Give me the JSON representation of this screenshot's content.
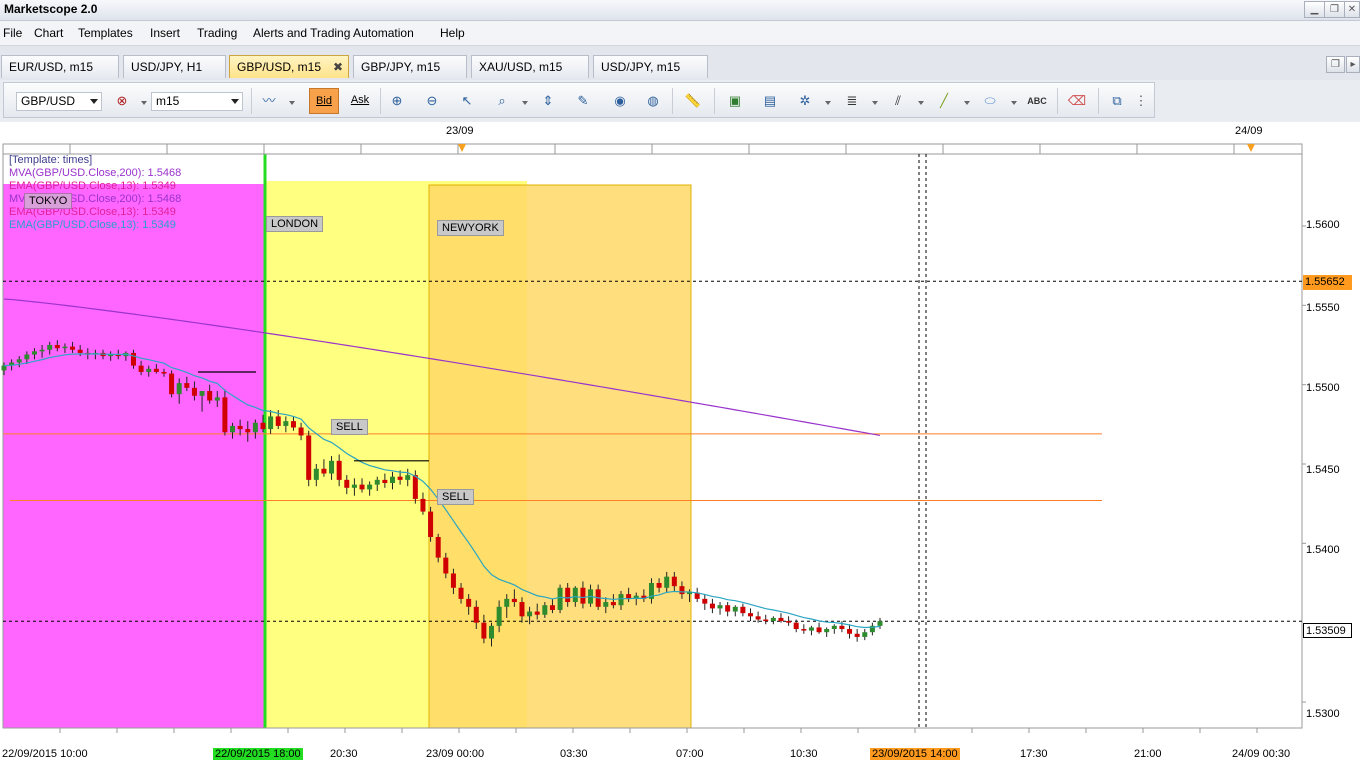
{
  "window": {
    "title": "Marketscope 2.0"
  },
  "menu": [
    "File",
    "Chart",
    "Templates",
    "Insert",
    "Trading",
    "Alerts and Trading Automation",
    "Help"
  ],
  "tabs": [
    {
      "label": "EUR/USD, m15"
    },
    {
      "label": "USD/JPY, H1"
    },
    {
      "label": "GBP/USD, m15",
      "close": "✖"
    },
    {
      "label": "GBP/JPY, m15"
    },
    {
      "label": "XAU/USD, m15"
    },
    {
      "label": "USD/JPY, m15"
    }
  ],
  "toolbar": {
    "symbol": "GBP/USD",
    "timeframe": "m15",
    "bid_label": "Bid",
    "ask_label": "Ask",
    "text_tool": "ABC"
  },
  "legend": [
    {
      "text": "[Template: times]",
      "color": "#3c3c8c"
    },
    {
      "text": "MVA(GBP/USD.Close,200): 1.5468",
      "color": "#9933cc"
    },
    {
      "text": "EMA(GBP/USD.Close,13): 1.5349",
      "color": "#e0209a"
    },
    {
      "text": "MVA(GBP/USD.Close,200): 1.5468",
      "color": "#9933cc"
    },
    {
      "text": "EMA(GBP/USD.Close,13): 1.5349",
      "color": "#e0209a"
    },
    {
      "text": "EMA(GBP/USD.Close,13): 1.5349",
      "color": "#2a9fc9"
    }
  ],
  "sessions": {
    "tokyo": "TOKYO",
    "london": "LONDON",
    "newyork": "NEWYORK"
  },
  "signals": {
    "sell1": "SELL",
    "sell2": "SELL"
  },
  "price_boxes": {
    "crosshair": "1.55652",
    "current": "1.53509"
  },
  "date_markers": {
    "top1": "23/09",
    "top2": "24/09"
  },
  "x_highlights": {
    "start": "22/09/2015 18:00",
    "end": "23/09/2015 14:00"
  },
  "colors": {
    "tokyo": "#ff66ff",
    "london": "#ffff80",
    "newyork": "#ffd966",
    "up": "#2e8b2e",
    "down": "#d00000",
    "ema": "#2aa5c2",
    "mva": "#9933cc",
    "level": "#ff7f27"
  },
  "chart_data": {
    "type": "candlestick",
    "y_ticks": [
      "1.5600",
      "1.5550",
      "1.5500",
      "1.5450",
      "1.5400",
      "1.5300"
    ],
    "x_ticks": [
      "22/09/2015 10:00",
      "22/09/2015 18:00",
      "20:30",
      "23/09 00:00",
      "03:30",
      "07:00",
      "10:30",
      "23/09/2015 14:00",
      "17:30",
      "21:00",
      "24/09 00:30"
    ],
    "ylim": [
      1.5285,
      1.565
    ],
    "candles": [
      [
        1.5509,
        1.5514,
        1.5506,
        1.5512
      ],
      [
        1.5512,
        1.5516,
        1.5509,
        1.5514
      ],
      [
        1.5514,
        1.5518,
        1.5511,
        1.5516
      ],
      [
        1.5516,
        1.5521,
        1.5513,
        1.5519
      ],
      [
        1.5519,
        1.5523,
        1.5516,
        1.5521
      ],
      [
        1.5521,
        1.5525,
        1.5517,
        1.5522
      ],
      [
        1.5522,
        1.5527,
        1.5519,
        1.5525
      ],
      [
        1.5525,
        1.5528,
        1.5521,
        1.5523
      ],
      [
        1.5523,
        1.5526,
        1.552,
        1.5524
      ],
      [
        1.5524,
        1.5527,
        1.552,
        1.5522
      ],
      [
        1.5522,
        1.5525,
        1.5518,
        1.552
      ],
      [
        1.552,
        1.5523,
        1.5516,
        1.5519
      ],
      [
        1.5519,
        1.5522,
        1.5516,
        1.552
      ],
      [
        1.552,
        1.5522,
        1.5516,
        1.5518
      ],
      [
        1.5518,
        1.5521,
        1.5515,
        1.5519
      ],
      [
        1.5519,
        1.5522,
        1.5516,
        1.5518
      ],
      [
        1.5518,
        1.5521,
        1.5515,
        1.552
      ],
      [
        1.552,
        1.5522,
        1.551,
        1.5512
      ],
      [
        1.5512,
        1.5515,
        1.5506,
        1.5508
      ],
      [
        1.5508,
        1.5512,
        1.5505,
        1.551
      ],
      [
        1.551,
        1.5513,
        1.5507,
        1.5508
      ],
      [
        1.5508,
        1.551,
        1.5505,
        1.5507
      ],
      [
        1.5507,
        1.5509,
        1.5492,
        1.5494
      ],
      [
        1.5494,
        1.5504,
        1.5488,
        1.5501
      ],
      [
        1.5501,
        1.5505,
        1.5496,
        1.5498
      ],
      [
        1.5498,
        1.5502,
        1.549,
        1.5493
      ],
      [
        1.5493,
        1.5496,
        1.5483,
        1.5496
      ],
      [
        1.5496,
        1.55,
        1.5488,
        1.549
      ],
      [
        1.549,
        1.5496,
        1.5486,
        1.5492
      ],
      [
        1.5492,
        1.5497,
        1.5468,
        1.547
      ],
      [
        1.547,
        1.5476,
        1.5466,
        1.5474
      ],
      [
        1.5474,
        1.5478,
        1.5468,
        1.5472
      ],
      [
        1.5472,
        1.5477,
        1.5464,
        1.547
      ],
      [
        1.547,
        1.5478,
        1.5466,
        1.5476
      ],
      [
        1.5476,
        1.5481,
        1.547,
        1.5472
      ],
      [
        1.5472,
        1.5484,
        1.5469,
        1.548
      ],
      [
        1.548,
        1.5484,
        1.5472,
        1.5474
      ],
      [
        1.5474,
        1.548,
        1.547,
        1.5477
      ],
      [
        1.5477,
        1.548,
        1.5471,
        1.5473
      ],
      [
        1.5473,
        1.5476,
        1.5465,
        1.5468
      ],
      [
        1.5468,
        1.5471,
        1.5436,
        1.544
      ],
      [
        1.544,
        1.545,
        1.5436,
        1.5447
      ],
      [
        1.5447,
        1.5453,
        1.5442,
        1.5444
      ],
      [
        1.5444,
        1.5455,
        1.544,
        1.5452
      ],
      [
        1.5452,
        1.5456,
        1.5436,
        1.544
      ],
      [
        1.544,
        1.5443,
        1.5431,
        1.5435
      ],
      [
        1.5435,
        1.5441,
        1.543,
        1.5437
      ],
      [
        1.5437,
        1.5441,
        1.5432,
        1.5434
      ],
      [
        1.5434,
        1.5439,
        1.543,
        1.5437
      ],
      [
        1.5437,
        1.5442,
        1.5433,
        1.544
      ],
      [
        1.544,
        1.5444,
        1.5435,
        1.5438
      ],
      [
        1.5438,
        1.5445,
        1.5434,
        1.5442
      ],
      [
        1.5442,
        1.5446,
        1.5437,
        1.544
      ],
      [
        1.544,
        1.5447,
        1.5436,
        1.5443
      ],
      [
        1.5443,
        1.5446,
        1.5425,
        1.5428
      ],
      [
        1.5428,
        1.5432,
        1.5418,
        1.542
      ],
      [
        1.542,
        1.5423,
        1.5401,
        1.5404
      ],
      [
        1.5404,
        1.5406,
        1.5388,
        1.5391
      ],
      [
        1.5391,
        1.5394,
        1.5378,
        1.5381
      ],
      [
        1.5381,
        1.5384,
        1.5368,
        1.5372
      ],
      [
        1.5372,
        1.5375,
        1.5362,
        1.5365
      ],
      [
        1.5365,
        1.5368,
        1.5355,
        1.536
      ],
      [
        1.536,
        1.5364,
        1.5346,
        1.535
      ],
      [
        1.535,
        1.5355,
        1.5337,
        1.534
      ],
      [
        1.534,
        1.535,
        1.5335,
        1.5348
      ],
      [
        1.5348,
        1.5364,
        1.5344,
        1.536
      ],
      [
        1.536,
        1.5368,
        1.5353,
        1.5365
      ],
      [
        1.5365,
        1.5371,
        1.536,
        1.5363
      ],
      [
        1.5363,
        1.5366,
        1.535,
        1.5354
      ],
      [
        1.5354,
        1.536,
        1.5349,
        1.5357
      ],
      [
        1.5357,
        1.5362,
        1.5352,
        1.5355
      ],
      [
        1.5355,
        1.5363,
        1.5353,
        1.5361
      ],
      [
        1.5361,
        1.5365,
        1.5356,
        1.5358
      ],
      [
        1.5358,
        1.5374,
        1.5356,
        1.5372
      ],
      [
        1.5372,
        1.5375,
        1.536,
        1.5363
      ],
      [
        1.5363,
        1.5373,
        1.536,
        1.5372
      ],
      [
        1.5372,
        1.5376,
        1.5359,
        1.5362
      ],
      [
        1.5362,
        1.5374,
        1.536,
        1.5371
      ],
      [
        1.5371,
        1.5374,
        1.5358,
        1.536
      ],
      [
        1.536,
        1.5366,
        1.5356,
        1.5363
      ],
      [
        1.5363,
        1.5368,
        1.5359,
        1.5361
      ],
      [
        1.5361,
        1.537,
        1.5358,
        1.5368
      ],
      [
        1.5368,
        1.5372,
        1.5363,
        1.5365
      ],
      [
        1.5365,
        1.5369,
        1.5361,
        1.5367
      ],
      [
        1.5367,
        1.5371,
        1.5363,
        1.5365
      ],
      [
        1.5365,
        1.5378,
        1.5362,
        1.5375
      ],
      [
        1.5375,
        1.5378,
        1.5369,
        1.5372
      ],
      [
        1.5372,
        1.5382,
        1.5369,
        1.5379
      ],
      [
        1.5379,
        1.5382,
        1.537,
        1.5373
      ],
      [
        1.5373,
        1.5376,
        1.5365,
        1.5368
      ],
      [
        1.5368,
        1.5371,
        1.5363,
        1.5369
      ],
      [
        1.5369,
        1.5372,
        1.5363,
        1.5365
      ],
      [
        1.5365,
        1.5368,
        1.5358,
        1.5362
      ],
      [
        1.5362,
        1.5365,
        1.5356,
        1.5359
      ],
      [
        1.5359,
        1.5363,
        1.5355,
        1.5361
      ],
      [
        1.5361,
        1.5363,
        1.5354,
        1.5357
      ],
      [
        1.5357,
        1.5361,
        1.5354,
        1.536
      ],
      [
        1.536,
        1.5362,
        1.5354,
        1.5356
      ],
      [
        1.5356,
        1.5359,
        1.5351,
        1.5354
      ],
      [
        1.5354,
        1.5357,
        1.535,
        1.5352
      ],
      [
        1.5352,
        1.5355,
        1.5349,
        1.5351
      ],
      [
        1.5351,
        1.5354,
        1.5349,
        1.5353
      ],
      [
        1.5353,
        1.5356,
        1.535,
        1.5351
      ],
      [
        1.5351,
        1.5354,
        1.5348,
        1.535
      ],
      [
        1.535,
        1.5352,
        1.5344,
        1.5346
      ],
      [
        1.5346,
        1.5349,
        1.5343,
        1.5345
      ],
      [
        1.5345,
        1.5348,
        1.5342,
        1.5347
      ],
      [
        1.5347,
        1.535,
        1.5343,
        1.5344
      ],
      [
        1.5344,
        1.5347,
        1.5341,
        1.5346
      ],
      [
        1.5346,
        1.5349,
        1.5343,
        1.5348
      ],
      [
        1.5348,
        1.5351,
        1.5344,
        1.5346
      ],
      [
        1.5346,
        1.5349,
        1.534,
        1.5343
      ],
      [
        1.5343,
        1.5346,
        1.5338,
        1.5341
      ],
      [
        1.5341,
        1.5346,
        1.5339,
        1.5344
      ],
      [
        1.5344,
        1.535,
        1.5342,
        1.5348
      ],
      [
        1.5348,
        1.5353,
        1.5346,
        1.5351
      ]
    ],
    "ema13_end": 1.5349,
    "mva200_end": 1.5468,
    "levels": [
      1.5469,
      1.5427
    ],
    "crosshair_price": 1.55652,
    "current_price": 1.53509
  }
}
